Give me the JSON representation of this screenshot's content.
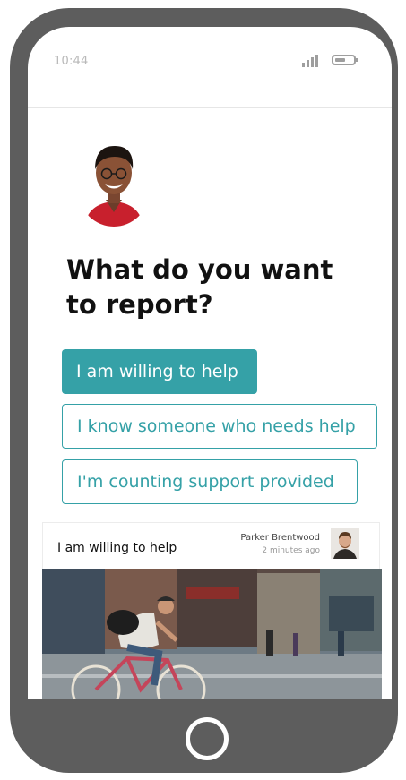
{
  "status_bar": {
    "time": "10:44",
    "signal_icon": "signal-bars-icon",
    "battery_icon": "battery-icon",
    "battery_level": 0.6
  },
  "profile": {
    "avatar_icon": "user-avatar"
  },
  "heading": "What do you want to report?",
  "options": [
    {
      "label": "I am willing to help",
      "selected": true
    },
    {
      "label": "I know someone who needs help",
      "selected": false
    },
    {
      "label": "I'm counting support provided",
      "selected": false
    }
  ],
  "card": {
    "title": "I am willing to help",
    "author": "Parker Brentwood",
    "time": "2 minutes ago",
    "author_avatar_icon": "author-avatar",
    "photo": "cyclist-city-street-photo"
  },
  "home_button_icon": "home-button-icon",
  "colors": {
    "accent": "#35a1a7",
    "phone_body": "#5d5d5d",
    "heading_text": "#111111"
  }
}
